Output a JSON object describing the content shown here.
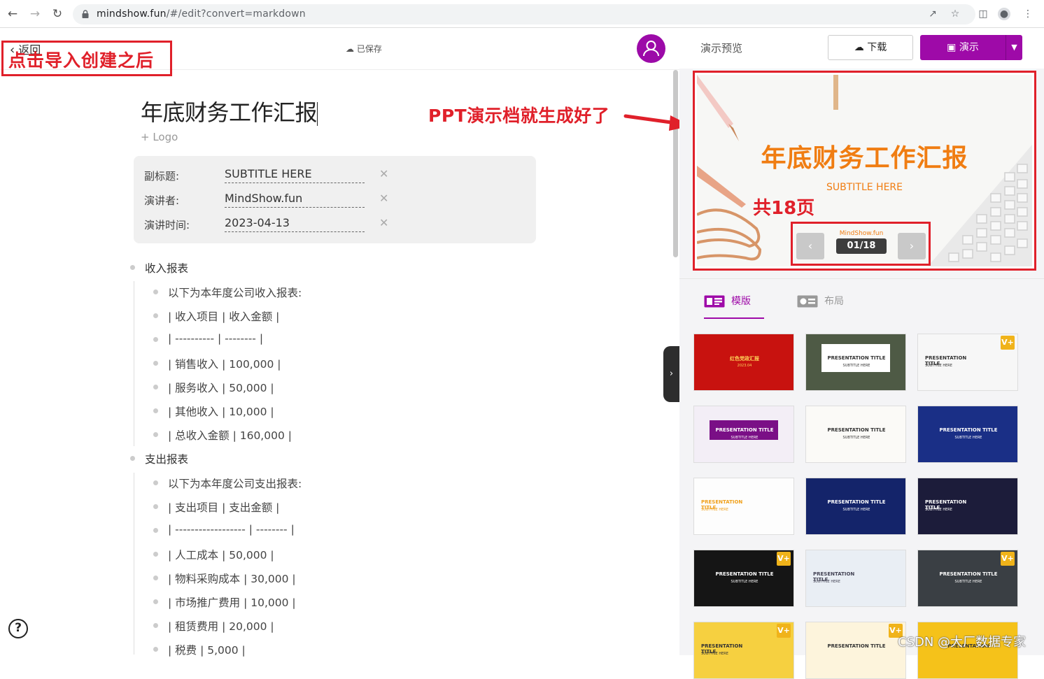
{
  "browser": {
    "url_host": "mindshow.fun",
    "url_path": "/#/edit?convert=markdown"
  },
  "editor": {
    "back_label": "返回",
    "saved_label": "已保存",
    "doc_title": "年底财务工作汇报",
    "logo_label": "+ Logo",
    "fields": [
      {
        "label": "副标题:",
        "value": "SUBTITLE HERE"
      },
      {
        "label": "演讲者:",
        "value": "MindShow.fun"
      },
      {
        "label": "演讲时间:",
        "value": "2023-04-13"
      }
    ],
    "sections": [
      {
        "title": "收入报表",
        "items": [
          "以下为本年度公司收入报表:",
          "| 收入项目 | 收入金额 |",
          "| ---------- | -------- |",
          "| 销售收入 | 100,000 |",
          "| 服务收入 | 50,000 |",
          "| 其他收入 | 10,000 |",
          "| 总收入金额 | 160,000 |"
        ]
      },
      {
        "title": "支出报表",
        "items": [
          "以下为本年度公司支出报表:",
          "| 支出项目 | 支出金额 |",
          "| ------------------ | -------- |",
          "| 人工成本 | 50,000 |",
          "| 物料采购成本 | 30,000 |",
          "| 市场推广费用 | 10,000 |",
          "| 租赁费用 | 20,000 |",
          "| 税费 | 5,000 |"
        ]
      }
    ]
  },
  "annotations": {
    "after_import": "点击导入创建之后",
    "ppt_ready": "PPT演示档就生成好了",
    "total_pages": "共18页"
  },
  "preview": {
    "panel_title": "演示预览",
    "download_label": "下载",
    "present_label": "演示",
    "slide_title": "年底财务工作汇报",
    "slide_subtitle": "SUBTITLE HERE",
    "slide_footer": "MindShow.fun",
    "page_indicator": "01/18",
    "tabs": [
      "模版",
      "布局"
    ]
  },
  "templates": [
    {
      "title": "红色党政汇报",
      "sub": "2023.04",
      "bg": "#c8120f",
      "fg": "#ffd75a",
      "badge": ""
    },
    {
      "title": "PRESENTATION TITLE",
      "sub": "SUBTITLE HERE",
      "bg": "#4e5a45",
      "fg": "#333",
      "badge": ""
    },
    {
      "title": "PRESENTATION TITLE",
      "sub": "SUBTITLE HERE",
      "bg": "#f7f7f7",
      "fg": "#333",
      "badge": "V+"
    },
    {
      "title": "PRESENTATION TITLE",
      "sub": "SUBTITLE HERE",
      "bg": "#f3eef6",
      "fg": "#fff",
      "badge": ""
    },
    {
      "title": "PRESENTATION TITLE",
      "sub": "SUBTITLE HERE",
      "bg": "#fbfaf7",
      "fg": "#333",
      "badge": ""
    },
    {
      "title": "PRESENTATION TITLE",
      "sub": "SUBTITLE HERE",
      "bg": "#1a2f86",
      "fg": "#fff",
      "badge": ""
    },
    {
      "title": "PRESENTATION TITLE",
      "sub": "SUBTITLE HERE",
      "bg": "#fdfdfd",
      "fg": "#f0a01a",
      "badge": ""
    },
    {
      "title": "PRESENTATION TITLE",
      "sub": "SUBTITLE HERE",
      "bg": "#14246a",
      "fg": "#fff",
      "badge": ""
    },
    {
      "title": "PRESENTATION TITLE",
      "sub": "SUBTITLE HERE",
      "bg": "#1c1c3a",
      "fg": "#fff",
      "badge": ""
    },
    {
      "title": "PRESENTATION TITLE",
      "sub": "SUBTITLE HERE",
      "bg": "#151515",
      "fg": "#fff",
      "badge": "V+"
    },
    {
      "title": "PRESENTATION TITLE",
      "sub": "SUBTITLE HERE",
      "bg": "#e9eef4",
      "fg": "#445",
      "badge": ""
    },
    {
      "title": "PRESENTATION TITLE",
      "sub": "SUBTITLE HERE",
      "bg": "#3a3f44",
      "fg": "#fff",
      "badge": "V+"
    },
    {
      "title": "PRESENTATION TITLE",
      "sub": "SUBTITLE HERE",
      "bg": "#f6d040",
      "fg": "#333",
      "badge": "V+"
    },
    {
      "title": "PRESENTATION TITLE",
      "sub": "",
      "bg": "#fdf4dc",
      "fg": "#333",
      "badge": "V+"
    },
    {
      "title": "PRESENTATION",
      "sub": "",
      "bg": "#f5c21a",
      "fg": "#333",
      "badge": ""
    }
  ],
  "watermark": "CSDN @大厂数据专家",
  "colors": {
    "accent": "#9e0aa8",
    "annotation": "#e0202a",
    "slide_orange": "#f07d12"
  }
}
